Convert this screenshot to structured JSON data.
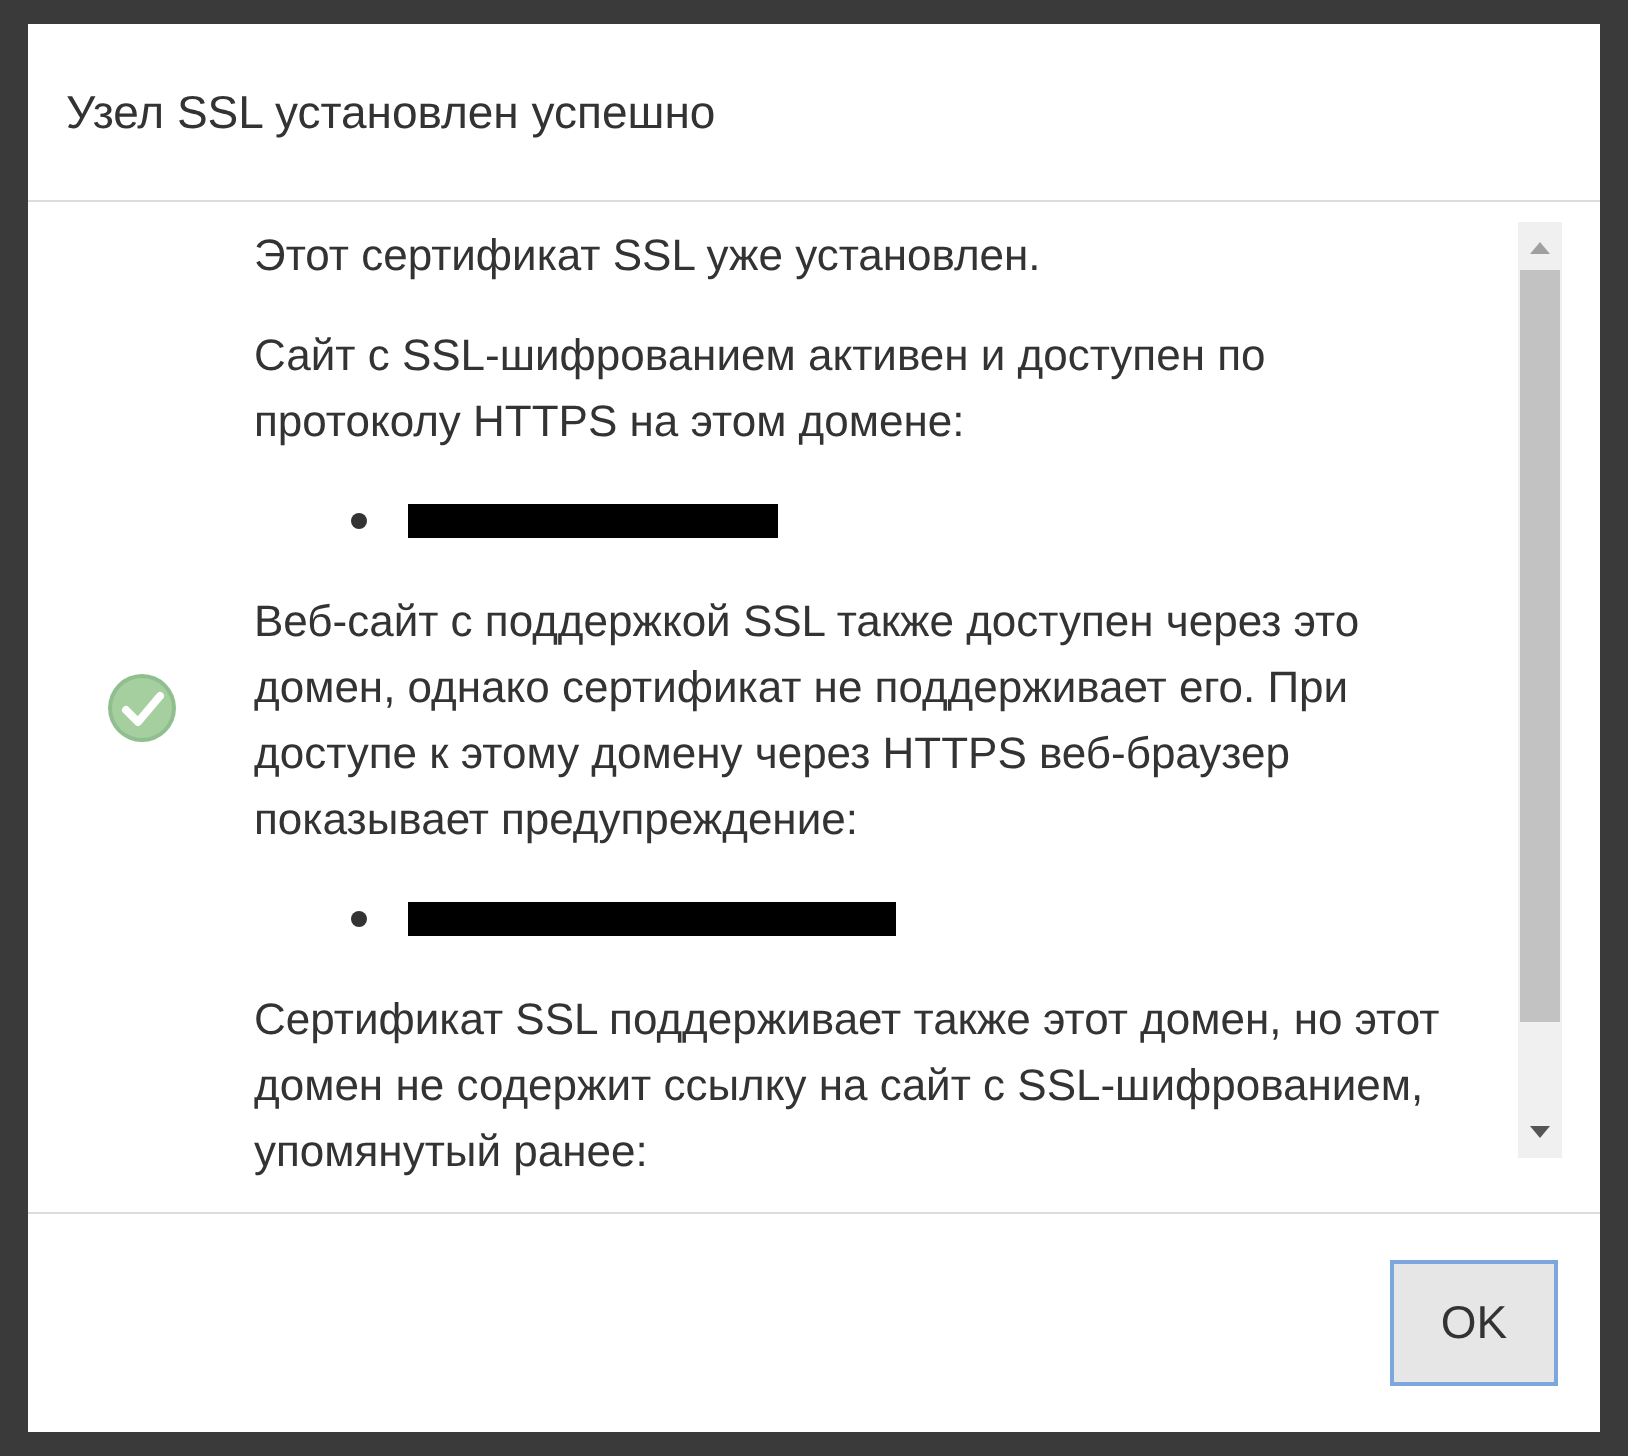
{
  "dialog": {
    "title": "Узел SSL установлен успешно",
    "content": [
      {
        "kind": "paragraph",
        "text": "Этот сертификат SSL уже установлен."
      },
      {
        "kind": "paragraph",
        "text": "Сайт с SSL-шифрованием активен и доступен по протоколу HTTPS на этом домене:"
      },
      {
        "kind": "redacted_link"
      },
      {
        "kind": "paragraph",
        "text": "Веб-сайт с поддержкой SSL также доступен через это домен, однако сертификат не поддерживает его. При доступе к этому домену через HTTPS веб-браузер показывает предупреждение:"
      },
      {
        "kind": "redacted_link"
      },
      {
        "kind": "paragraph",
        "text": "Сертификат SSL поддерживает также этот домен, но этот домен не содержит ссылку на сайт с SSL-шифрованием, упомянутый ранее:"
      }
    ],
    "buttons": [
      "OK"
    ]
  }
}
